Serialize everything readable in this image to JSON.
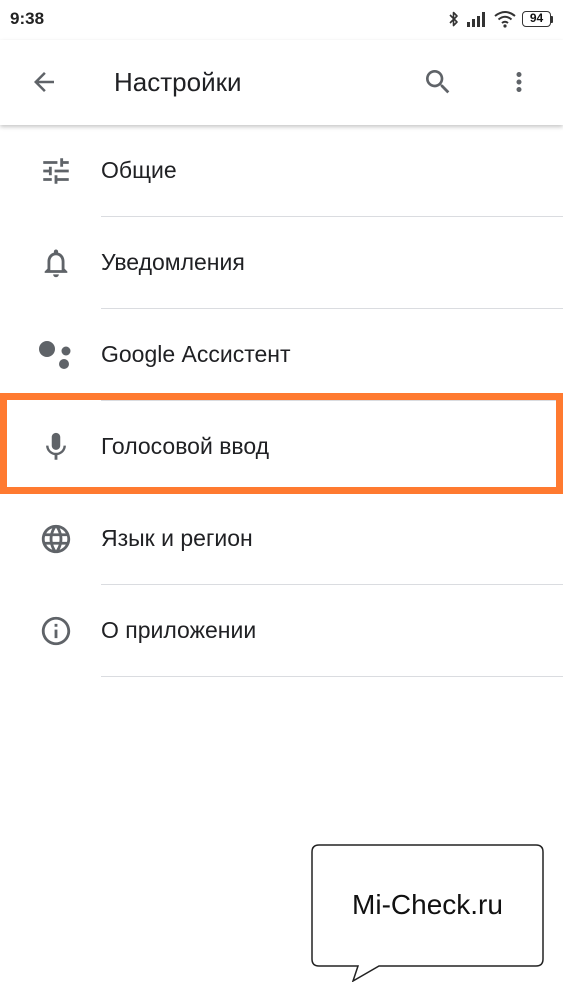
{
  "status_bar": {
    "time": "9:38",
    "battery_level": "94",
    "icons": [
      "bluetooth-icon",
      "signal-icon",
      "wifi-icon",
      "battery-icon"
    ]
  },
  "app_bar": {
    "title": "Настройки",
    "icons": [
      "back-arrow-icon",
      "search-icon",
      "more-vert-icon"
    ]
  },
  "settings": {
    "items": [
      {
        "label": "Общие",
        "icon": "tune-icon"
      },
      {
        "label": "Уведомления",
        "icon": "bell-icon"
      },
      {
        "label": "Google Ассистент",
        "icon": "assistant-icon"
      },
      {
        "label": "Голосовой ввод",
        "icon": "mic-icon"
      },
      {
        "label": "Язык и регион",
        "icon": "globe-icon"
      },
      {
        "label": "О приложении",
        "icon": "info-icon"
      }
    ]
  },
  "highlight": {
    "color": "#ff7a30"
  },
  "watermark": {
    "text": "Mi-Check.ru"
  },
  "colors": {
    "icon": "#5f6368",
    "text": "#202124",
    "divider": "#dadce0"
  }
}
